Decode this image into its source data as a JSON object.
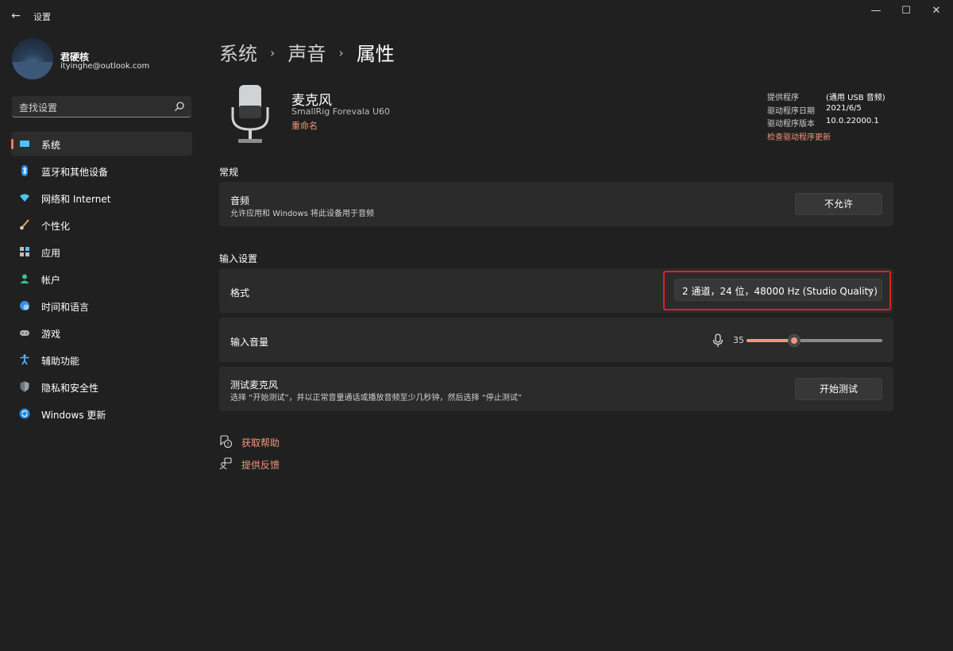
{
  "window": {
    "title": "设置",
    "back_glyph": "←",
    "minimize_glyph": "—",
    "maximize_glyph": "☐",
    "close_glyph": "✕"
  },
  "profile": {
    "name": "君硬核",
    "email": "ityinghe@outlook.com"
  },
  "search": {
    "placeholder": "查找设置"
  },
  "sidebar": {
    "items": [
      {
        "label": "系统",
        "icon": "display-icon",
        "active": true
      },
      {
        "label": "蓝牙和其他设备",
        "icon": "bluetooth-icon"
      },
      {
        "label": "网络和 Internet",
        "icon": "wifi-icon"
      },
      {
        "label": "个性化",
        "icon": "brush-icon"
      },
      {
        "label": "应用",
        "icon": "apps-icon"
      },
      {
        "label": "帐户",
        "icon": "person-icon"
      },
      {
        "label": "时间和语言",
        "icon": "globe-clock-icon"
      },
      {
        "label": "游戏",
        "icon": "gamepad-icon"
      },
      {
        "label": "辅助功能",
        "icon": "accessibility-icon"
      },
      {
        "label": "隐私和安全性",
        "icon": "shield-icon"
      },
      {
        "label": "Windows 更新",
        "icon": "update-icon"
      }
    ]
  },
  "breadcrumb": {
    "items": [
      "系统",
      "声音",
      "属性"
    ],
    "separator": "›"
  },
  "device": {
    "name": "麦克风",
    "model": "SmallRig Forevala U60",
    "rename_label": "重命名"
  },
  "driver": {
    "rows": [
      {
        "label": "提供程序",
        "value": "(通用 USB 音频)"
      },
      {
        "label": "驱动程序日期",
        "value": "2021/6/5"
      },
      {
        "label": "驱动程序版本",
        "value": "10.0.22000.1"
      }
    ],
    "update_link": "检查驱动程序更新"
  },
  "general": {
    "section_title": "常规",
    "audio_title": "音频",
    "audio_desc": "允许应用和 Windows 将此设备用于音频",
    "disallow_button": "不允许"
  },
  "input_settings": {
    "section_title": "输入设置",
    "format_label": "格式",
    "format_value": "2 通道，24 位，48000 Hz (Studio Quality)",
    "volume_label": "输入音量",
    "volume_value": "35",
    "volume_fraction": 0.35,
    "test_title": "测试麦克风",
    "test_desc": "选择 “开始测试”，并以正常音量通话或播放音频至少几秒钟，然后选择 “停止测试”",
    "test_button": "开始测试"
  },
  "links": {
    "help": "获取帮助",
    "feedback": "提供反馈"
  },
  "colors": {
    "accent": "#f0987a",
    "highlight_border": "#e02020",
    "background": "#202020",
    "card": "#2b2b2b"
  }
}
